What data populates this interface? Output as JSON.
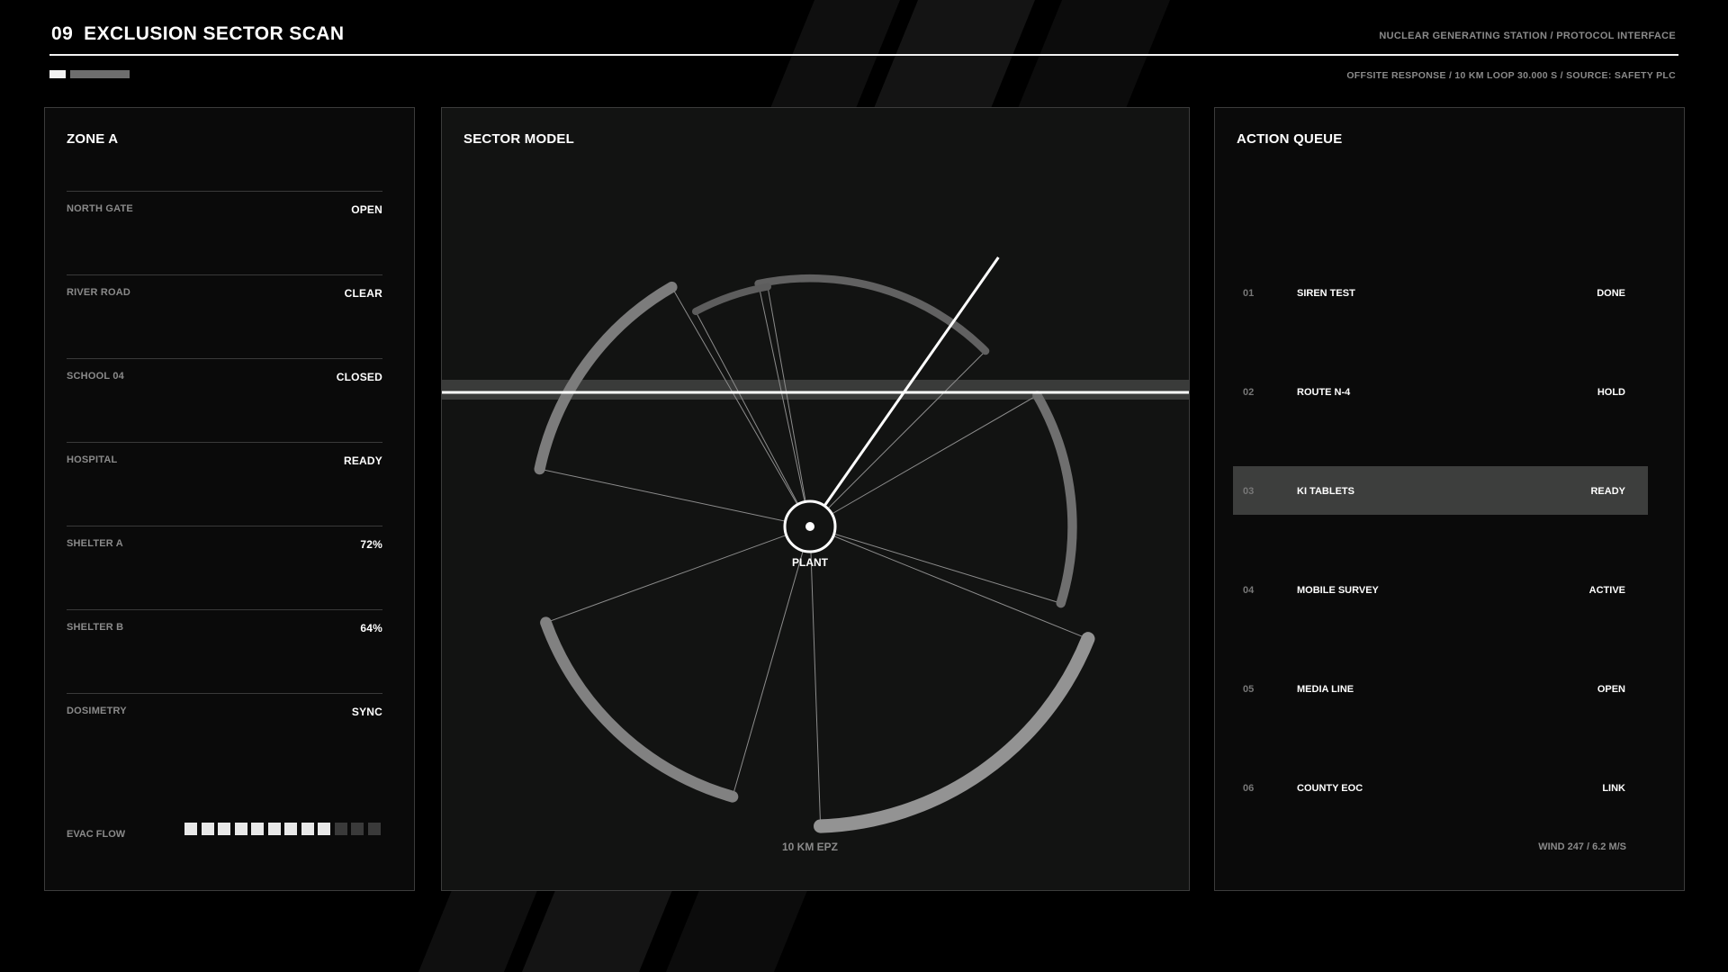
{
  "header": {
    "number": "09",
    "title": "EXCLUSION SECTOR SCAN",
    "right_label": "NUCLEAR GENERATING STATION / PROTOCOL INTERFACE",
    "sub_label": "OFFSITE RESPONSE / 10 KM  LOOP 30.000 S  /  SOURCE: SAFETY PLC"
  },
  "zone": {
    "title": "ZONE A",
    "rows": [
      {
        "label": "NORTH GATE",
        "value": "OPEN"
      },
      {
        "label": "RIVER ROAD",
        "value": "CLEAR"
      },
      {
        "label": "SCHOOL 04",
        "value": "CLOSED"
      },
      {
        "label": "HOSPITAL",
        "value": "READY"
      },
      {
        "label": "SHELTER A",
        "value": "72%"
      },
      {
        "label": "SHELTER B",
        "value": "64%"
      },
      {
        "label": "DOSIMETRY",
        "value": "SYNC"
      }
    ],
    "evac_label": "EVAC FLOW",
    "evac_filled": 9,
    "evac_total": 12
  },
  "sector": {
    "title": "SECTOR MODEL",
    "center_label": "PLANT",
    "ring_label": "10 KM EPZ",
    "sectors": [
      {
        "from": -12,
        "to": 45,
        "level": 0.3
      },
      {
        "from": 60,
        "to": 107,
        "level": 0.45
      },
      {
        "from": 112,
        "to": 178,
        "level": 0.85
      },
      {
        "from": 196,
        "to": 250,
        "level": 0.65
      },
      {
        "from": 282,
        "to": 330,
        "level": 0.6
      },
      {
        "from": 332,
        "to": 350,
        "level": 0.25
      }
    ],
    "sweep_angle": 35
  },
  "queue": {
    "title": "ACTION QUEUE",
    "items": [
      {
        "num": "01",
        "label": "SIREN TEST",
        "status": "DONE",
        "active": false
      },
      {
        "num": "02",
        "label": "ROUTE N-4",
        "status": "HOLD",
        "active": false
      },
      {
        "num": "03",
        "label": "KI TABLETS",
        "status": "READY",
        "active": true
      },
      {
        "num": "04",
        "label": "MOBILE SURVEY",
        "status": "ACTIVE",
        "active": false
      },
      {
        "num": "05",
        "label": "MEDIA LINE",
        "status": "OPEN",
        "active": false
      },
      {
        "num": "06",
        "label": "COUNTY EOC",
        "status": "LINK",
        "active": false
      }
    ],
    "wind": "WIND 247 / 6.2 M/S"
  },
  "colors": {
    "accent": "#ffffff",
    "muted": "#8a8a8a",
    "panel": "#0a0a0a",
    "sector_bg": "#121312",
    "highlight": "#3d3e3d"
  }
}
